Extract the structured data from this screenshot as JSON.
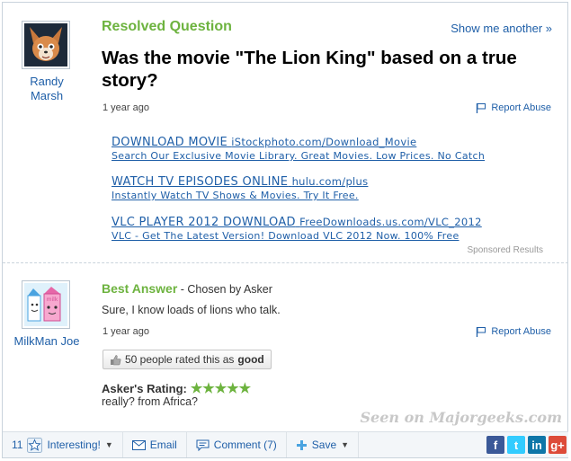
{
  "asker": {
    "name": "Randy Marsh"
  },
  "header": {
    "status": "Resolved Question",
    "show_another": "Show me another »"
  },
  "question": {
    "title": "Was the movie \"The Lion King\" based on a true story?",
    "time": "1 year ago",
    "report": "Report Abuse"
  },
  "ads": [
    {
      "title": "DOWNLOAD MOVIE",
      "domain": "iStockphoto.com/Download_Movie",
      "desc": "Search Our Exclusive Movie Library. Great Movies. Low Prices. No Catch"
    },
    {
      "title": "WATCH TV EPISODES ONLINE",
      "domain": "hulu.com/plus",
      "desc": "Instantly Watch TV Shows & Movies. Try It Free."
    },
    {
      "title": "VLC PLAYER 2012 DOWNLOAD",
      "domain": "FreeDownloads.us.com/VLC_2012",
      "desc": "VLC - Get The Latest Version! Download VLC 2012 Now. 100% Free"
    }
  ],
  "sponsored": "Sponsored Results",
  "answer": {
    "user": "MilkMan Joe",
    "label": "Best Answer",
    "chosen": " - Chosen by Asker",
    "text": "Sure, I know loads of lions who talk.",
    "time": "1 year ago",
    "report": "Report Abuse",
    "rated_prefix": "50 people rated this as",
    "rated_value": "good",
    "rating_label": "Asker's Rating:",
    "stars": "★★★★★",
    "rating_comment": "really? from Africa?"
  },
  "watermark": "Seen on Majorgeeks.com",
  "toolbar": {
    "interesting_count": "11",
    "interesting": "Interesting!",
    "email": "Email",
    "comment": "Comment (7)",
    "save": "Save"
  },
  "colors": {
    "green": "#6db33f",
    "link": "#1f5fa8",
    "facebook": "#3b5998",
    "twitter": "#33ccff",
    "linkedin": "#0e76a8",
    "google": "#dd4b39"
  }
}
